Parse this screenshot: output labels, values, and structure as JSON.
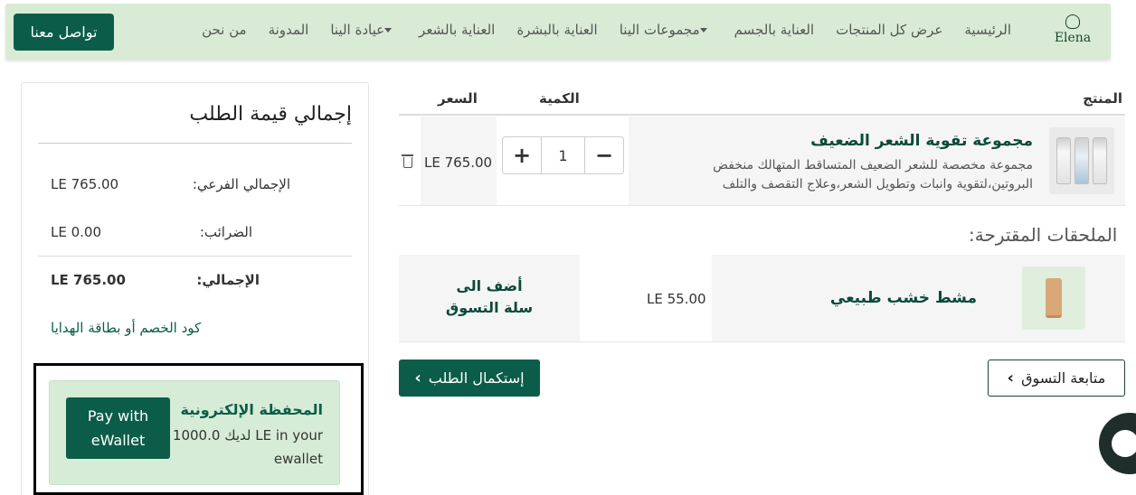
{
  "navbar": {
    "logo_text": "Elena",
    "links": [
      {
        "label": "الرئيسية"
      },
      {
        "label": "عرض كل المنتجات"
      },
      {
        "label": "العناية بالجسم"
      },
      {
        "label": "مجموعات الينا",
        "dropdown": true
      },
      {
        "label": "العناية بالبشرة"
      },
      {
        "label": "العناية بالشعر"
      },
      {
        "label": "عيادة الينا",
        "dropdown": true
      },
      {
        "label": "المدونة"
      },
      {
        "label": "من نحن"
      }
    ],
    "contact_label": "تواصل معنا"
  },
  "cart": {
    "headers": {
      "product": "المنتج",
      "quantity": "الكمية",
      "price": "السعر"
    },
    "items": [
      {
        "name": "مجموعة تقوية الشعر الضعيف",
        "description": "مجموعة مخصصة للشعر الضعيف المتساقط المتهالك منخفض البروتين،لتقوية وانبات وتطويل الشعر،وعلاج التقصف والتلف",
        "quantity": "1",
        "price": "LE 765.00"
      }
    ],
    "suggested_title": "الملحقات المقترحة:",
    "suggested": [
      {
        "name": "مشط خشب طبيعي",
        "price": "LE 55.00",
        "add_label": "أضف الى سلة التسوق"
      }
    ],
    "checkout_label": "إستكمال الطلب",
    "continue_label": "متابعة التسوق"
  },
  "summary": {
    "title": "إجمالي قيمة الطلب",
    "subtotal_label": "الإجمالي الفرعي:",
    "subtotal_value": "LE 765.00",
    "tax_label": "الضرائب:",
    "tax_value": "LE 0.00",
    "total_label": "الإجمالي:",
    "total_value": "LE 765.00",
    "discount_link": "كود الخصم أو بطاقة الهدايا",
    "ewallet": {
      "title": "المحفظة الإلكترونية",
      "balance_text": "لديك 1000.0 LE in your ewallet",
      "pay_label": "Pay with eWallet"
    }
  },
  "colors": {
    "brand": "#0b5d49",
    "nav_bg": "#d9ebd5",
    "wallet_bg": "#d6ecd6"
  },
  "icons": [
    "plus-icon",
    "minus-icon",
    "trash-icon",
    "chevron-left-icon",
    "chevron-right-icon",
    "chat-icon",
    "caret-down-icon"
  ]
}
